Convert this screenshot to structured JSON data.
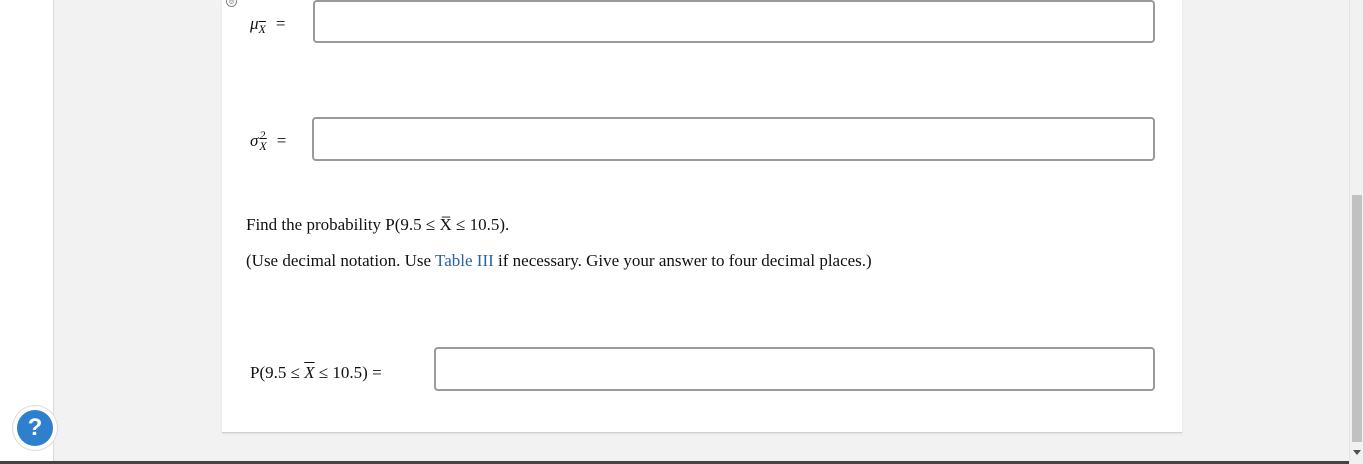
{
  "fields": {
    "mean": {
      "label_symbol": "μ",
      "label_sub": "X",
      "equals": "=",
      "value": ""
    },
    "variance": {
      "label_symbol": "σ",
      "label_sup": "2",
      "label_sub": "X",
      "equals": "=",
      "value": ""
    }
  },
  "question": {
    "prompt_text": "Find the probability P(9.5 ≤ X̅ ≤ 10.5).",
    "instruction_before_link": "(Use decimal notation. Use ",
    "link_text": "Table III",
    "instruction_after_link": " if necessary. Give your answer to four decimal places.)"
  },
  "probability_field": {
    "label_prefix": "P(9.5 ≤ ",
    "label_var": "X",
    "label_suffix": " ≤ 10.5) =",
    "value": ""
  },
  "help": {
    "label": "?"
  },
  "colors": {
    "link": "#2a62a8",
    "help_button": "#2f7fcf"
  }
}
